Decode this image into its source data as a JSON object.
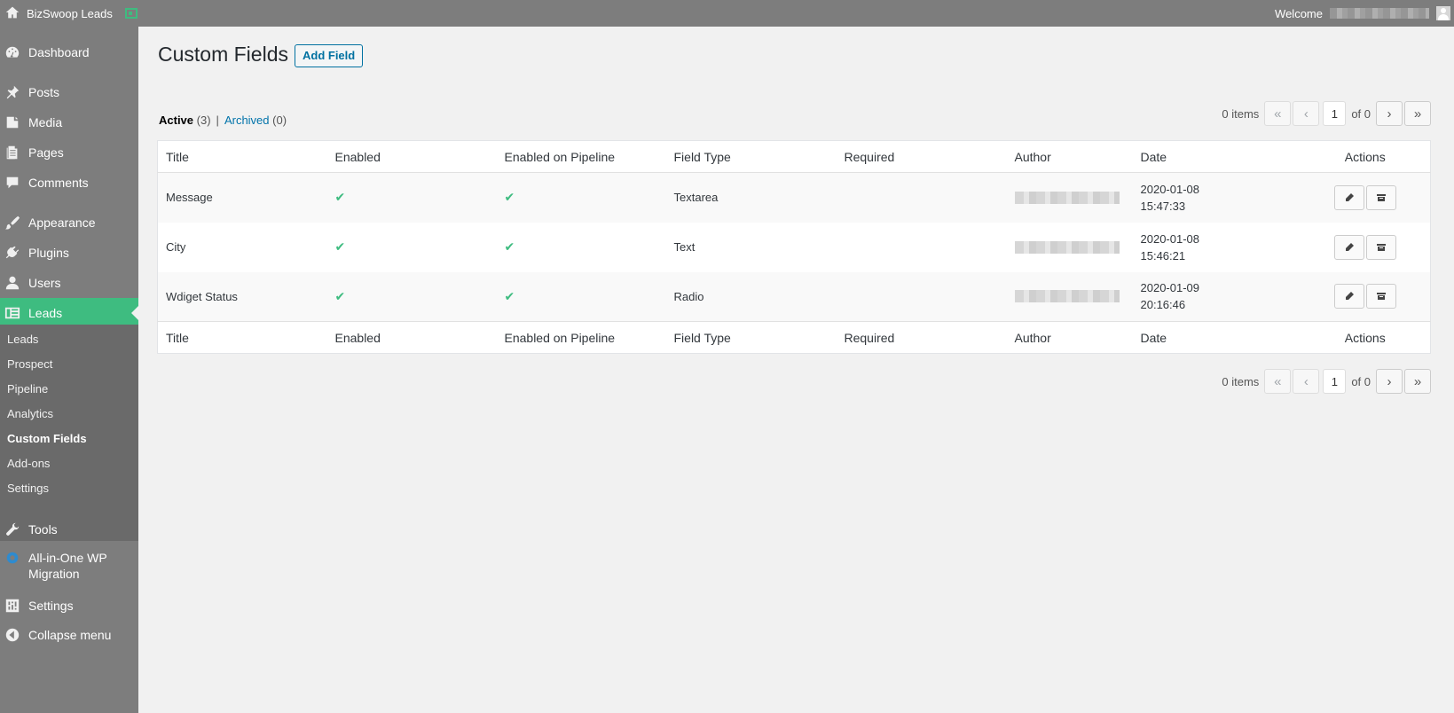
{
  "adminbar": {
    "site_name": "BizSwoop Leads",
    "welcome": "Welcome"
  },
  "sidebar": {
    "menu": [
      {
        "label": "Dashboard",
        "icon": "dashboard-icon"
      },
      {
        "label": "Posts",
        "icon": "pin-icon"
      },
      {
        "label": "Media",
        "icon": "media-icon"
      },
      {
        "label": "Pages",
        "icon": "pages-icon"
      },
      {
        "label": "Comments",
        "icon": "comment-icon"
      },
      {
        "label": "Appearance",
        "icon": "brush-icon"
      },
      {
        "label": "Plugins",
        "icon": "plug-icon"
      },
      {
        "label": "Users",
        "icon": "user-icon"
      },
      {
        "label": "Leads",
        "icon": "leads-icon"
      },
      {
        "label": "Tools",
        "icon": "wrench-icon"
      },
      {
        "label": "All-in-One WP Migration",
        "icon": "migration-icon"
      },
      {
        "label": "Settings",
        "icon": "settings-icon"
      },
      {
        "label": "Collapse menu",
        "icon": "collapse-icon"
      }
    ],
    "submenu": [
      "Leads",
      "Prospect",
      "Pipeline",
      "Analytics",
      "Custom Fields",
      "Add-ons",
      "Settings"
    ]
  },
  "page": {
    "title": "Custom Fields",
    "add_button": "Add Field"
  },
  "views": {
    "active_label": "Active",
    "active_count": "(3)",
    "separator": "|",
    "archived_label": "Archived",
    "archived_count": "(0)"
  },
  "pagination": {
    "items": "0 items",
    "first": "«",
    "prev": "‹",
    "current": "1",
    "of": "of 0",
    "next": "›",
    "last": "»"
  },
  "table": {
    "columns": [
      "Title",
      "Enabled",
      "Enabled on Pipeline",
      "Field Type",
      "Required",
      "Author",
      "Date",
      "Actions"
    ],
    "check_glyph": "✔",
    "rows": [
      {
        "title": "Message",
        "field_type": "Textarea",
        "date": "2020-01-08",
        "time": "15:47:33"
      },
      {
        "title": "City",
        "field_type": "Text",
        "date": "2020-01-08",
        "time": "15:46:21"
      },
      {
        "title": "Wdiget Status",
        "field_type": "Radio",
        "date": "2020-01-09",
        "time": "20:16:46"
      }
    ]
  },
  "colors": {
    "accent": "#3ebc80",
    "link": "#0073aa",
    "sidebar": "#7d7d7d"
  }
}
